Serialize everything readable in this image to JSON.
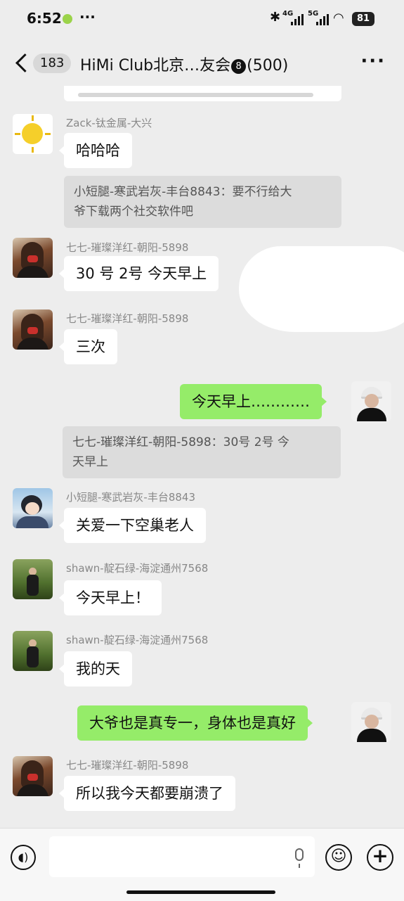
{
  "status_bar": {
    "time": "6:52",
    "dots": "···",
    "net1": "4G",
    "net2": "5G",
    "battery": "81"
  },
  "header": {
    "unread_count": "183",
    "title_part1": "HiMi Club北京…友会",
    "title_badge": "8",
    "title_part2": "(500)",
    "more": "···"
  },
  "messages": [
    {
      "sender": "Zack-钛金属-大兴",
      "text": "哈哈哈",
      "avatar": "sun-avatar"
    },
    {
      "quote": "小短腿-寒武岩灰-丰台8843：要不行给大爷下载两个社交软件吧"
    },
    {
      "sender": "七七-璀璨洋红-朝阳-5898",
      "text": "30 号 2号 今天早上",
      "avatar": "girl-avatar"
    },
    {
      "sender": "七七-璀璨洋红-朝阳-5898",
      "text": "三次",
      "avatar": "girl-avatar"
    },
    {
      "sender": "me",
      "text": "今天早上…………",
      "avatar": "self-avatar"
    },
    {
      "quote": "七七-璀璨洋红-朝阳-5898：30号 2号 今天早上"
    },
    {
      "sender": "小短腿-寒武岩灰-丰台8843",
      "text": "关爱一下空巢老人",
      "avatar": "anime-avatar"
    },
    {
      "sender": "shawn-靛石绿-海淀通州7568",
      "text": "今天早上！",
      "avatar": "tree-avatar"
    },
    {
      "sender": "shawn-靛石绿-海淀通州7568",
      "text": "我的天",
      "avatar": "tree-avatar"
    },
    {
      "sender": "me",
      "text": "大爷也是真专一，身体也是真好",
      "avatar": "self-avatar"
    },
    {
      "sender": "七七-璀璨洋红-朝阳-5898",
      "text": "所以我今天都要崩溃了",
      "avatar": "girl-avatar"
    }
  ],
  "quotes": {
    "q1_line1": "小短腿-寒武岩灰-丰台8843：要不行给大",
    "q1_line2": "爷下载两个社交软件吧",
    "q2_line1": "七七-璀璨洋红-朝阳-5898：30号 2号 今",
    "q2_line2": "天早上"
  },
  "input_bar": {
    "voice_icon": "voice-icon",
    "emoji_icon": "emoji-icon",
    "plus_icon": "plus-icon",
    "mic_icon": "mic-icon"
  },
  "colors": {
    "background": "#ededed",
    "my_bubble": "#95ec69",
    "other_bubble": "#ffffff",
    "quote_bg": "#dcdcdc",
    "name_text": "#888888"
  }
}
